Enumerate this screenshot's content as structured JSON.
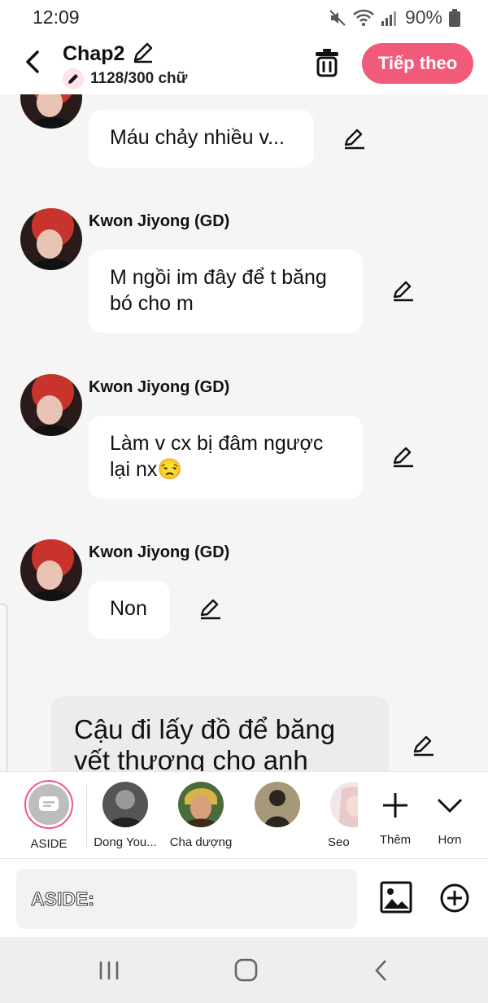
{
  "status": {
    "time": "12:09",
    "battery": "90%"
  },
  "header": {
    "title": "Chap2",
    "word_count": "1128/300 chữ",
    "next_label": "Tiếp theo",
    "accent": "#f25a7a"
  },
  "messages": [
    {
      "name": "",
      "text": "Máu chảy nhiều v..."
    },
    {
      "name": "Kwon Jiyong (GD)",
      "text": "M ngồi im đây để t băng bó cho m"
    },
    {
      "name": "Kwon Jiyong (GD)",
      "text": "Làm v cx bị đâm ngược lại nx😒"
    },
    {
      "name": "Kwon Jiyong (GD)",
      "text": "Non"
    }
  ],
  "narration": {
    "text": "Cậu đi lấy đồ để băng vết thương cho anh"
  },
  "characters": [
    {
      "label": "ASIDE"
    },
    {
      "label": "Dong You..."
    },
    {
      "label": "Cha dượng"
    },
    {
      "label": ""
    },
    {
      "label": "Seo"
    }
  ],
  "actions": {
    "add_label": "Thêm",
    "more_label": "Hơn"
  },
  "input": {
    "placeholder": "ASIDE:"
  }
}
